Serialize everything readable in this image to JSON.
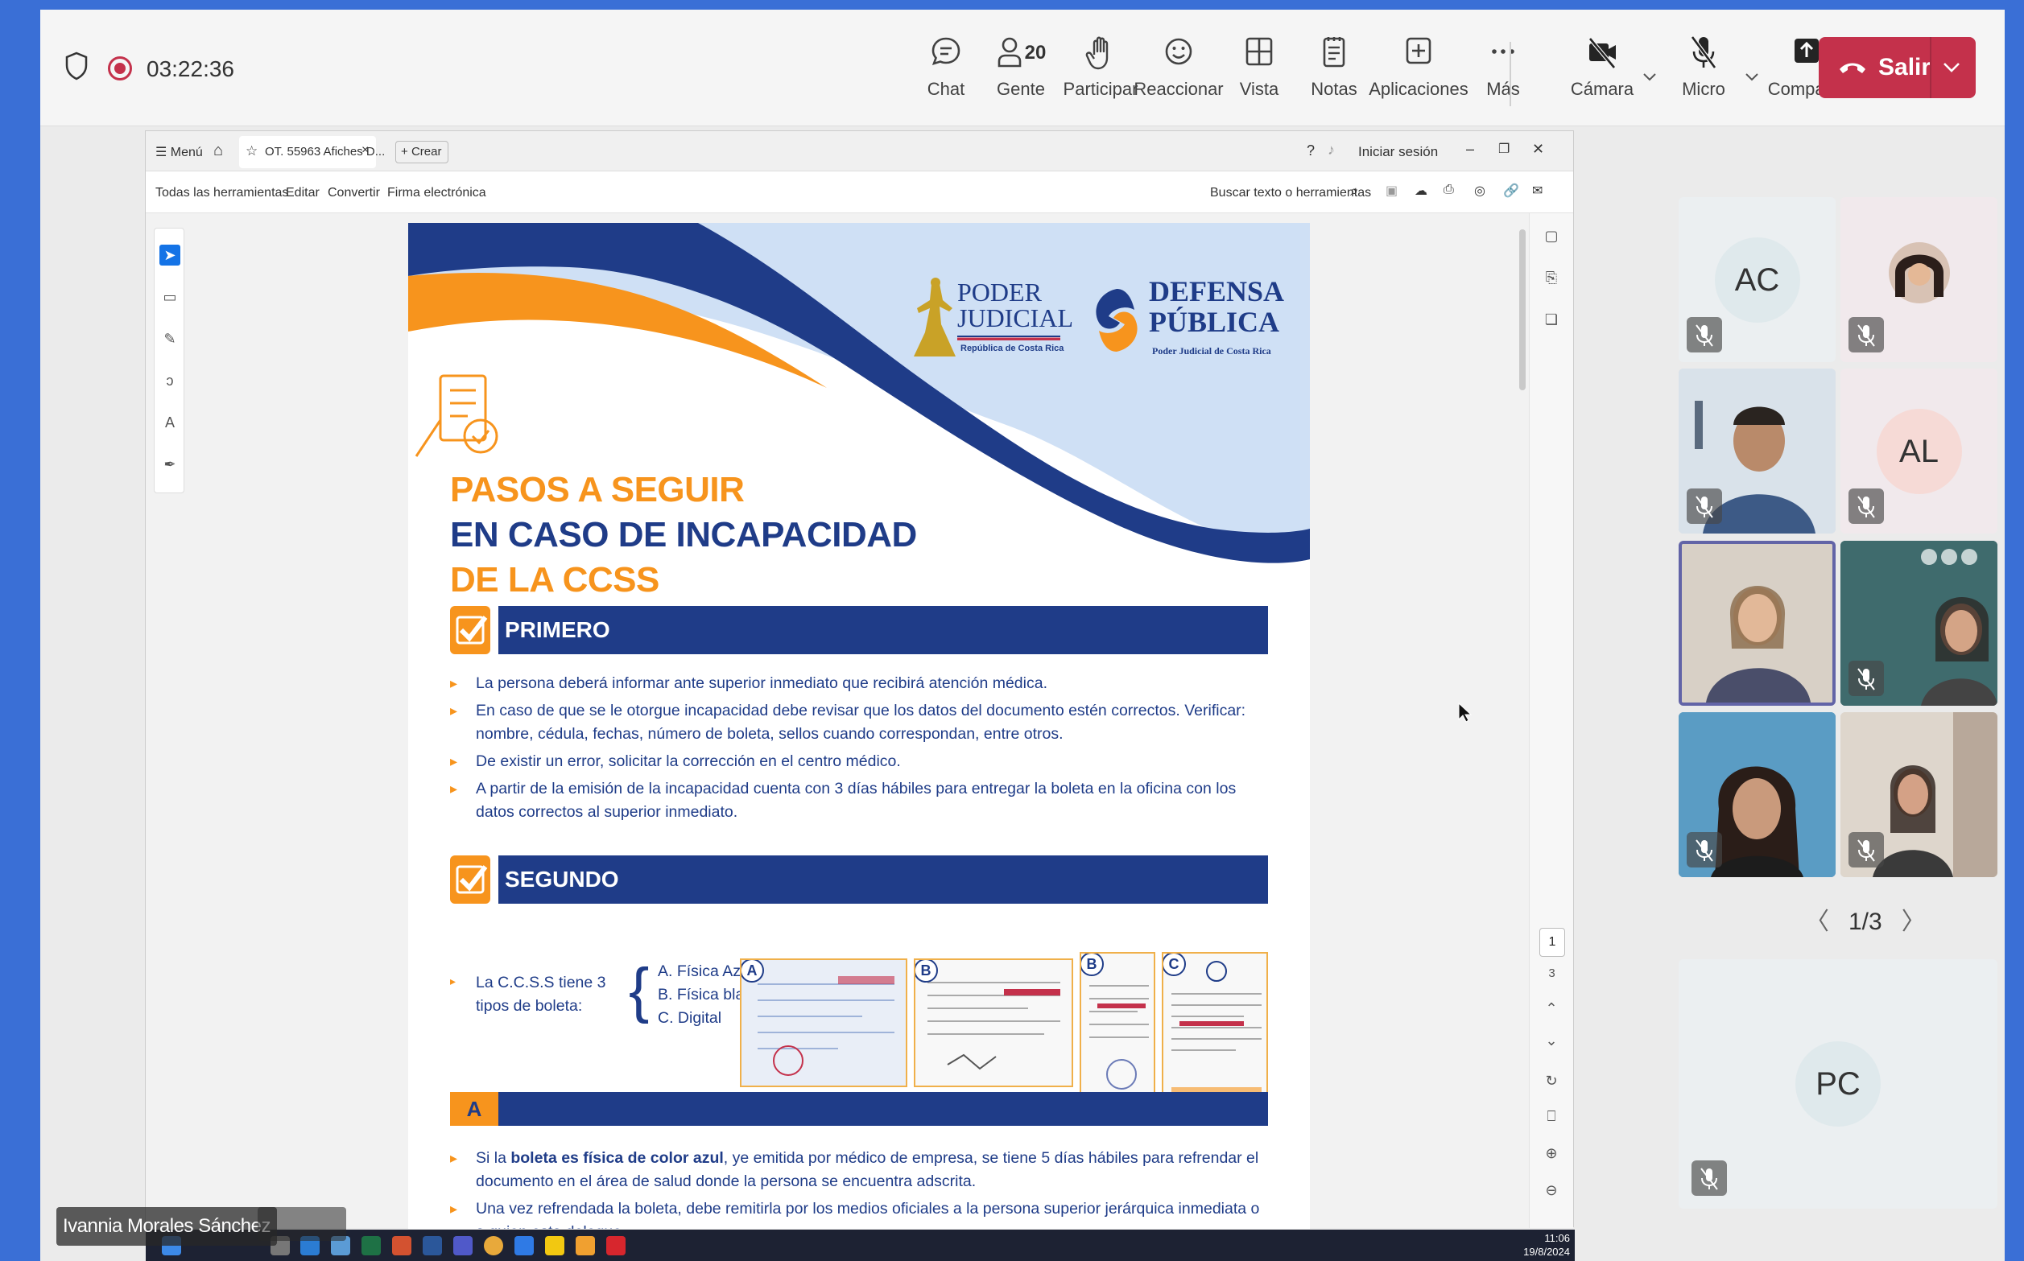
{
  "meeting": {
    "timer": "03:22:36",
    "toolbar": [
      {
        "label": "Chat",
        "icon": "chat-icon"
      },
      {
        "label": "Gente",
        "icon": "people-icon",
        "count": "20"
      },
      {
        "label": "Participar",
        "icon": "raise-hand-icon"
      },
      {
        "label": "Reaccionar",
        "icon": "smiley-icon"
      },
      {
        "label": "Vista",
        "icon": "grid-view-icon"
      },
      {
        "label": "Notas",
        "icon": "notes-icon"
      },
      {
        "label": "Aplicaciones",
        "icon": "add-app-icon"
      },
      {
        "label": "Más",
        "icon": "more-icon"
      },
      {
        "label": "Cámara",
        "icon": "camera-off-icon"
      },
      {
        "label": "Micro",
        "icon": "mic-off-icon"
      },
      {
        "label": "Compartir",
        "icon": "share-icon"
      }
    ],
    "leave_label": "Salir",
    "accent": "#c4314b",
    "presenter_name": "Ivannia Morales Sánchez",
    "pager": "1/3",
    "participants": [
      {
        "initials": "AC",
        "avatar_color": "#dfe9ec"
      },
      {
        "initials": "",
        "avatar_color": ""
      },
      {
        "initials": "",
        "avatar_color": ""
      },
      {
        "initials": "AL",
        "avatar_color": "#f6dad6"
      },
      {
        "initials": "",
        "avatar_color": ""
      },
      {
        "initials": "",
        "avatar_color": ""
      },
      {
        "initials": "",
        "avatar_color": ""
      },
      {
        "initials": "",
        "avatar_color": ""
      },
      {
        "initials": "PC",
        "avatar_color": "#dfe9ec"
      }
    ]
  },
  "acrobat": {
    "menu_label": "Menú",
    "tab_title": "OT. 55963 Afiches D...",
    "create_label": "Crear",
    "signin_label": "Iniciar sesión",
    "menu_items": [
      "Todas las herramientas",
      "Editar",
      "Convertir",
      "Firma electrónica"
    ],
    "search_label": "Buscar texto o herramientas",
    "page_current": "1",
    "page_total": "3",
    "clock_time": "11:06",
    "clock_date": "19/8/2024"
  },
  "document": {
    "logo_pj_line1": "PODER",
    "logo_pj_line2": "JUDICIAL",
    "logo_pj_sub": "República de Costa Rica",
    "logo_dp_line1": "DEFENSA",
    "logo_dp_line2": "PÚBLICA",
    "logo_dp_sub": "Poder Judicial de Costa Rica",
    "title_line1": "PASOS A SEGUIR",
    "title_line2": "EN CASO DE INCAPACIDAD",
    "title_line3": "DE LA CCSS",
    "section1": "PRIMERO",
    "section1_bullets": [
      "La persona deberá informar ante superior inmediato que recibirá atención médica.",
      "En caso de que se le otorgue incapacidad debe revisar que los datos del documento estén correctos. Verificar: nombre, cédula, fechas, número de boleta, sellos cuando correspondan, entre otros.",
      "De existir un error, solicitar la corrección en el centro médico.",
      "A partir de la emisión de la incapacidad cuenta con 3 días hábiles para entregar la boleta en la oficina con los datos correctos al superior inmediato."
    ],
    "section2": "SEGUNDO",
    "types_intro_line1": "La C.C.S.S tiene 3",
    "types_intro_line2": "tipos de boleta:",
    "types": [
      "A.  Física Azul",
      "B.  Física blanca",
      "C.  Digital"
    ],
    "thumb_labels": [
      "A",
      "B",
      "B",
      "C"
    ],
    "section_a": "A",
    "a_bullet1_pre": "Si la ",
    "a_bullet1_bold": "boleta es física de color azul",
    "a_bullet1_post": ", ye emitida por médico de empresa, se tiene 5 días hábiles para refrendar el documento en el área de salud donde la persona se encuentra adscrita.",
    "a_bullet2": "Una vez refrendada la boleta, debe remitirla por los medios oficiales a la persona superior jerárquica inmediata o a quien esta delegue.",
    "colors": {
      "orange": "#f7941d",
      "navy": "#1f3c88",
      "light_blue": "#cfe0f5"
    }
  }
}
